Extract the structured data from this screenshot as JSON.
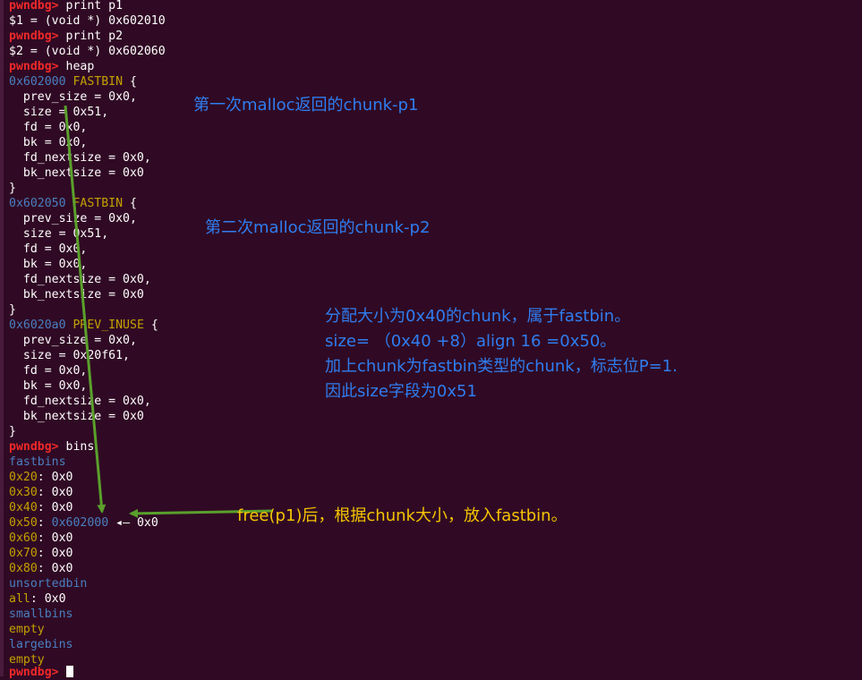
{
  "terminal": {
    "prompt": "pwndbg>",
    "cmd_print_p1": "print p1",
    "out_p1_label": "$1",
    "out_p1_value": " = (void *) 0x602010",
    "cmd_print_p2": "print p2",
    "out_p2_label": "$2",
    "out_p2_value": " = (void *) 0x602060",
    "cmd_heap": "heap",
    "chunk1": {
      "addr": "0x602000",
      "type": "FASTBIN",
      "open": " {",
      "fields": [
        "  prev_size = 0x0,",
        "  size = 0x51,",
        "  fd = 0x0,",
        "  bk = 0x0,",
        "  fd_nextsize = 0x0,",
        "  bk_nextsize = 0x0"
      ],
      "close": "}"
    },
    "chunk2": {
      "addr": "0x602050",
      "type": "FASTBIN",
      "open": " {",
      "fields": [
        "  prev_size = 0x0,",
        "  size = 0x51,",
        "  fd = 0x0,",
        "  bk = 0x0,",
        "  fd_nextsize = 0x0,",
        "  bk_nextsize = 0x0"
      ],
      "close": "}"
    },
    "chunk3": {
      "addr": "0x6020a0",
      "type": "PREV_INUSE",
      "open": " {",
      "fields": [
        "  prev_size = 0x0,",
        "  size = 0x20f61,",
        "  fd = 0x0,",
        "  bk = 0x0,",
        "  fd_nextsize = 0x0,",
        "  bk_nextsize = 0x0"
      ],
      "close": "}"
    },
    "cmd_bins": "bins",
    "fastbins_header": "fastbins",
    "fastbins": [
      {
        "size": "0x20",
        "value": ": 0x0"
      },
      {
        "size": "0x30",
        "value": ": 0x0"
      },
      {
        "size": "0x40",
        "value": ": 0x0"
      },
      {
        "size": "0x50",
        "sep": ": ",
        "ptr": "0x602000",
        "arrow": " ◂— ",
        "tail": "0x0"
      },
      {
        "size": "0x60",
        "value": ": 0x0"
      },
      {
        "size": "0x70",
        "value": ": 0x0"
      },
      {
        "size": "0x80",
        "value": ": 0x0"
      }
    ],
    "unsortedbin_header": "unsortedbin",
    "unsorted_all_label": "all",
    "unsorted_all_value": ": 0x0",
    "smallbins_header": "smallbins",
    "smallbins_value": "empty",
    "largebins_header": "largebins",
    "largebins_value": "empty"
  },
  "annotations": {
    "note1": "第一次malloc返回的chunk-p1",
    "note2": "第二次malloc返回的chunk-p2",
    "note3": [
      "分配大小为0x40的chunk，属于fastbin。",
      "size= （0x40 +8）align 16 =0x50。",
      "加上chunk为fastbin类型的chunk，标志位P=1.",
      "因此size字段为0x51"
    ],
    "note4": "free(p1)后，根据chunk大小，放入fastbin。"
  },
  "colors": {
    "background": "#300a24",
    "prompt": "#ef2929",
    "address": "#4a7fc1",
    "label": "#c4a000",
    "annotation": "#2f7df0",
    "annotation_highlight": "#f5c400",
    "arrow": "#5aa02c"
  }
}
